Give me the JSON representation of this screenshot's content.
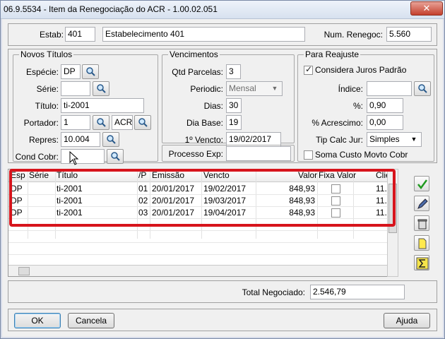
{
  "window": {
    "title": "06.9.5534 - Item da Renegociação do ACR - 1.00.02.051",
    "close_label": "✕"
  },
  "header": {
    "estab_label": "Estab:",
    "estab_value": "401",
    "estab_desc": "Estabelecimento 401",
    "renegoc_label": "Num. Renegoc:",
    "renegoc_value": "5.560"
  },
  "novos_titulos": {
    "title": "Novos Títulos",
    "especie_label": "Espécie:",
    "especie_value": "DP",
    "serie_label": "Série:",
    "serie_value": "",
    "titulo_label": "Título:",
    "titulo_value": "ti-2001",
    "portador_label": "Portador:",
    "portador_value": "1",
    "portador_code": "ACR",
    "repres_label": "Repres:",
    "repres_value": "10.004",
    "condcobr_label": "Cond Cobr:",
    "condcobr_value": ""
  },
  "vencimentos": {
    "title": "Vencimentos",
    "qtd_label": "Qtd Parcelas:",
    "qtd_value": "3",
    "periodic_label": "Periodic:",
    "periodic_value": "Mensal",
    "dias_label": "Dias:",
    "dias_value": "30",
    "diabase_label": "Dia Base:",
    "diabase_value": "19",
    "vencto_label": "1º Vencto:",
    "vencto_value": "19/02/2017",
    "processo_label": "Processo Exp:",
    "processo_value": ""
  },
  "reajuste": {
    "title": "Para Reajuste",
    "considera_label": "Considera Juros Padrão",
    "considera_checked": true,
    "indice_label": "Índice:",
    "indice_value": "",
    "pct_label": "%:",
    "pct_value": "0,90",
    "acrescimo_label": "% Acrescimo:",
    "acrescimo_value": "0,00",
    "tipcalc_label": "Tip Calc Jur:",
    "tipcalc_value": "Simples",
    "soma_label": "Soma Custo Movto Cobr",
    "soma_checked": false
  },
  "grid": {
    "columns": [
      "Esp",
      "Série",
      "Título",
      "/P",
      "Emissão",
      "Vencto",
      "Valor",
      "Fixa Valor",
      "Clie"
    ],
    "rows": [
      {
        "esp": "DP",
        "serie": "",
        "titulo": "ti-2001",
        "p": "01",
        "emissao": "20/01/2017",
        "vencto": "19/02/2017",
        "valor": "848,93",
        "cli": "11."
      },
      {
        "esp": "DP",
        "serie": "",
        "titulo": "ti-2001",
        "p": "02",
        "emissao": "20/01/2017",
        "vencto": "19/03/2017",
        "valor": "848,93",
        "cli": "11."
      },
      {
        "esp": "DP",
        "serie": "",
        "titulo": "ti-2001",
        "p": "03",
        "emissao": "20/01/2017",
        "vencto": "19/04/2017",
        "valor": "848,93",
        "cli": "11."
      }
    ]
  },
  "totals": {
    "label": "Total Negociado:",
    "value": "2.546,79"
  },
  "buttons": {
    "ok": "OK",
    "cancel": "Cancela",
    "help": "Ajuda"
  },
  "colors": {
    "highlight": "#d7141c"
  }
}
